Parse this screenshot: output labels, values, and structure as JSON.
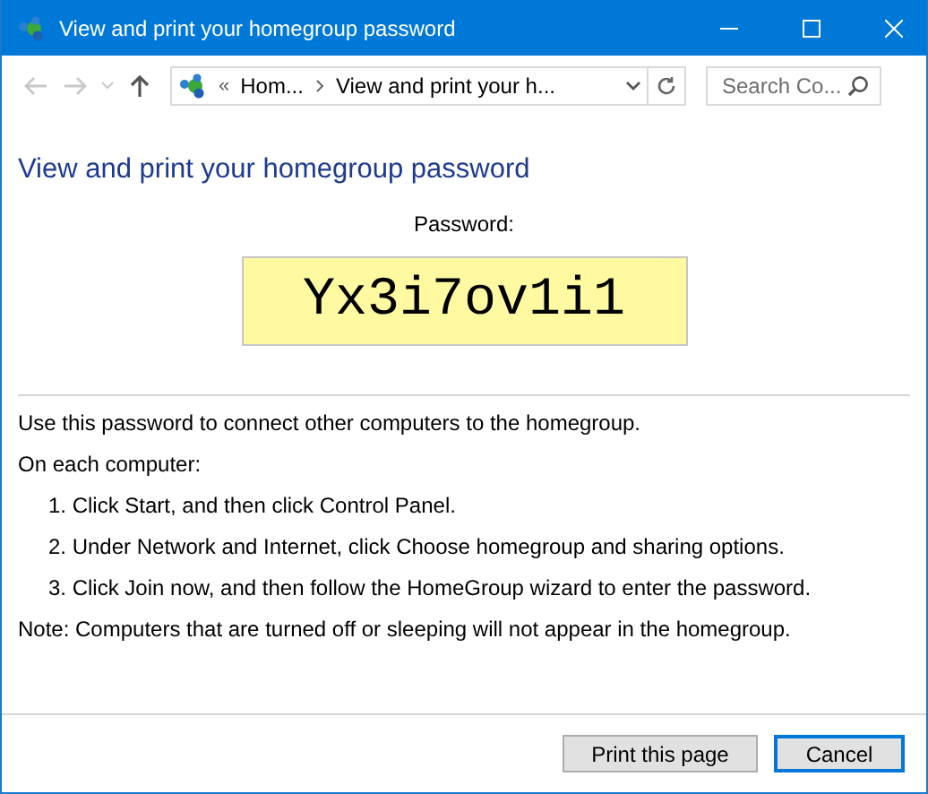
{
  "window": {
    "title": "View and print your homegroup password"
  },
  "nav": {
    "back": {
      "disabled": true
    },
    "forward": {
      "disabled": true
    },
    "recent": {
      "disabled": true
    },
    "up": {
      "disabled": false
    }
  },
  "address": {
    "overflow": "«",
    "crumbs": [
      "Hom...",
      "View and print your h..."
    ]
  },
  "search": {
    "placeholder": "Search Co..."
  },
  "heading": "View and print your homegroup password",
  "password_label": "Password:",
  "password": "Yx3i7ov1i1",
  "intro": "Use this password to connect other computers to the homegroup.",
  "steps_title": "On each computer:",
  "steps": [
    "1. Click Start, and then click Control Panel.",
    "2. Under Network and Internet, click Choose homegroup and sharing options.",
    "3. Click Join now, and then follow the HomeGroup wizard to enter the password."
  ],
  "note": "Note: Computers that are turned off or sleeping will not appear in the homegroup.",
  "buttons": [
    {
      "label": "Print this page",
      "default": false
    },
    {
      "label": "Cancel",
      "default": true
    }
  ]
}
